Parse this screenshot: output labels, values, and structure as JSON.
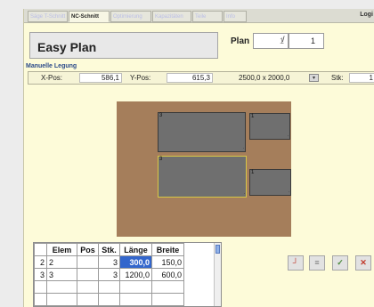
{
  "tabs": [
    {
      "label": "Säge T-Schnitt",
      "active": false
    },
    {
      "label": "NC-Schnitt",
      "active": true
    },
    {
      "label": "Optimierung",
      "active": false
    },
    {
      "label": "Kapazitäten",
      "active": false
    },
    {
      "label": "Teile",
      "active": false
    },
    {
      "label": "Info",
      "active": false
    }
  ],
  "login_label": "Logi",
  "title": "Easy Plan",
  "plan": {
    "label": "Plan",
    "current": "1",
    "separator": "/",
    "total": "1"
  },
  "section_label": "Manuelle Legung",
  "position": {
    "x_label": "X-Pos:",
    "x_value": "586,1",
    "y_label": "Y-Pos:",
    "y_value": "615,3",
    "dims": "2500,0 x 2000,0",
    "dims_btn": "▾",
    "stk_label": "Stk:",
    "stk_value": "1"
  },
  "panels": [
    {
      "num": "3",
      "corner": "."
    },
    {
      "num": "1",
      "corner": "."
    },
    {
      "num": "3",
      "corner": "."
    },
    {
      "num": "1",
      "corner": "."
    }
  ],
  "grid": {
    "columns": [
      "",
      "Elem",
      "Pos",
      "Stk.",
      "Länge",
      "Breite"
    ],
    "rows": [
      [
        "2",
        "2",
        "",
        "3",
        "300,0",
        "150,0"
      ],
      [
        "3",
        "3",
        "",
        "3",
        "1200,0",
        "600,0"
      ],
      [
        "",
        "",
        "",
        "",
        "",
        ""
      ],
      [
        "",
        "",
        "",
        "",
        "",
        ""
      ]
    ]
  },
  "toolbar": [
    "┘",
    "≡",
    "✓",
    "✕"
  ],
  "colors": {
    "board": "#a57e5b",
    "panel": "#6f6f6f",
    "window_bg": "#fdfbd9",
    "selection": "#3366cc"
  }
}
